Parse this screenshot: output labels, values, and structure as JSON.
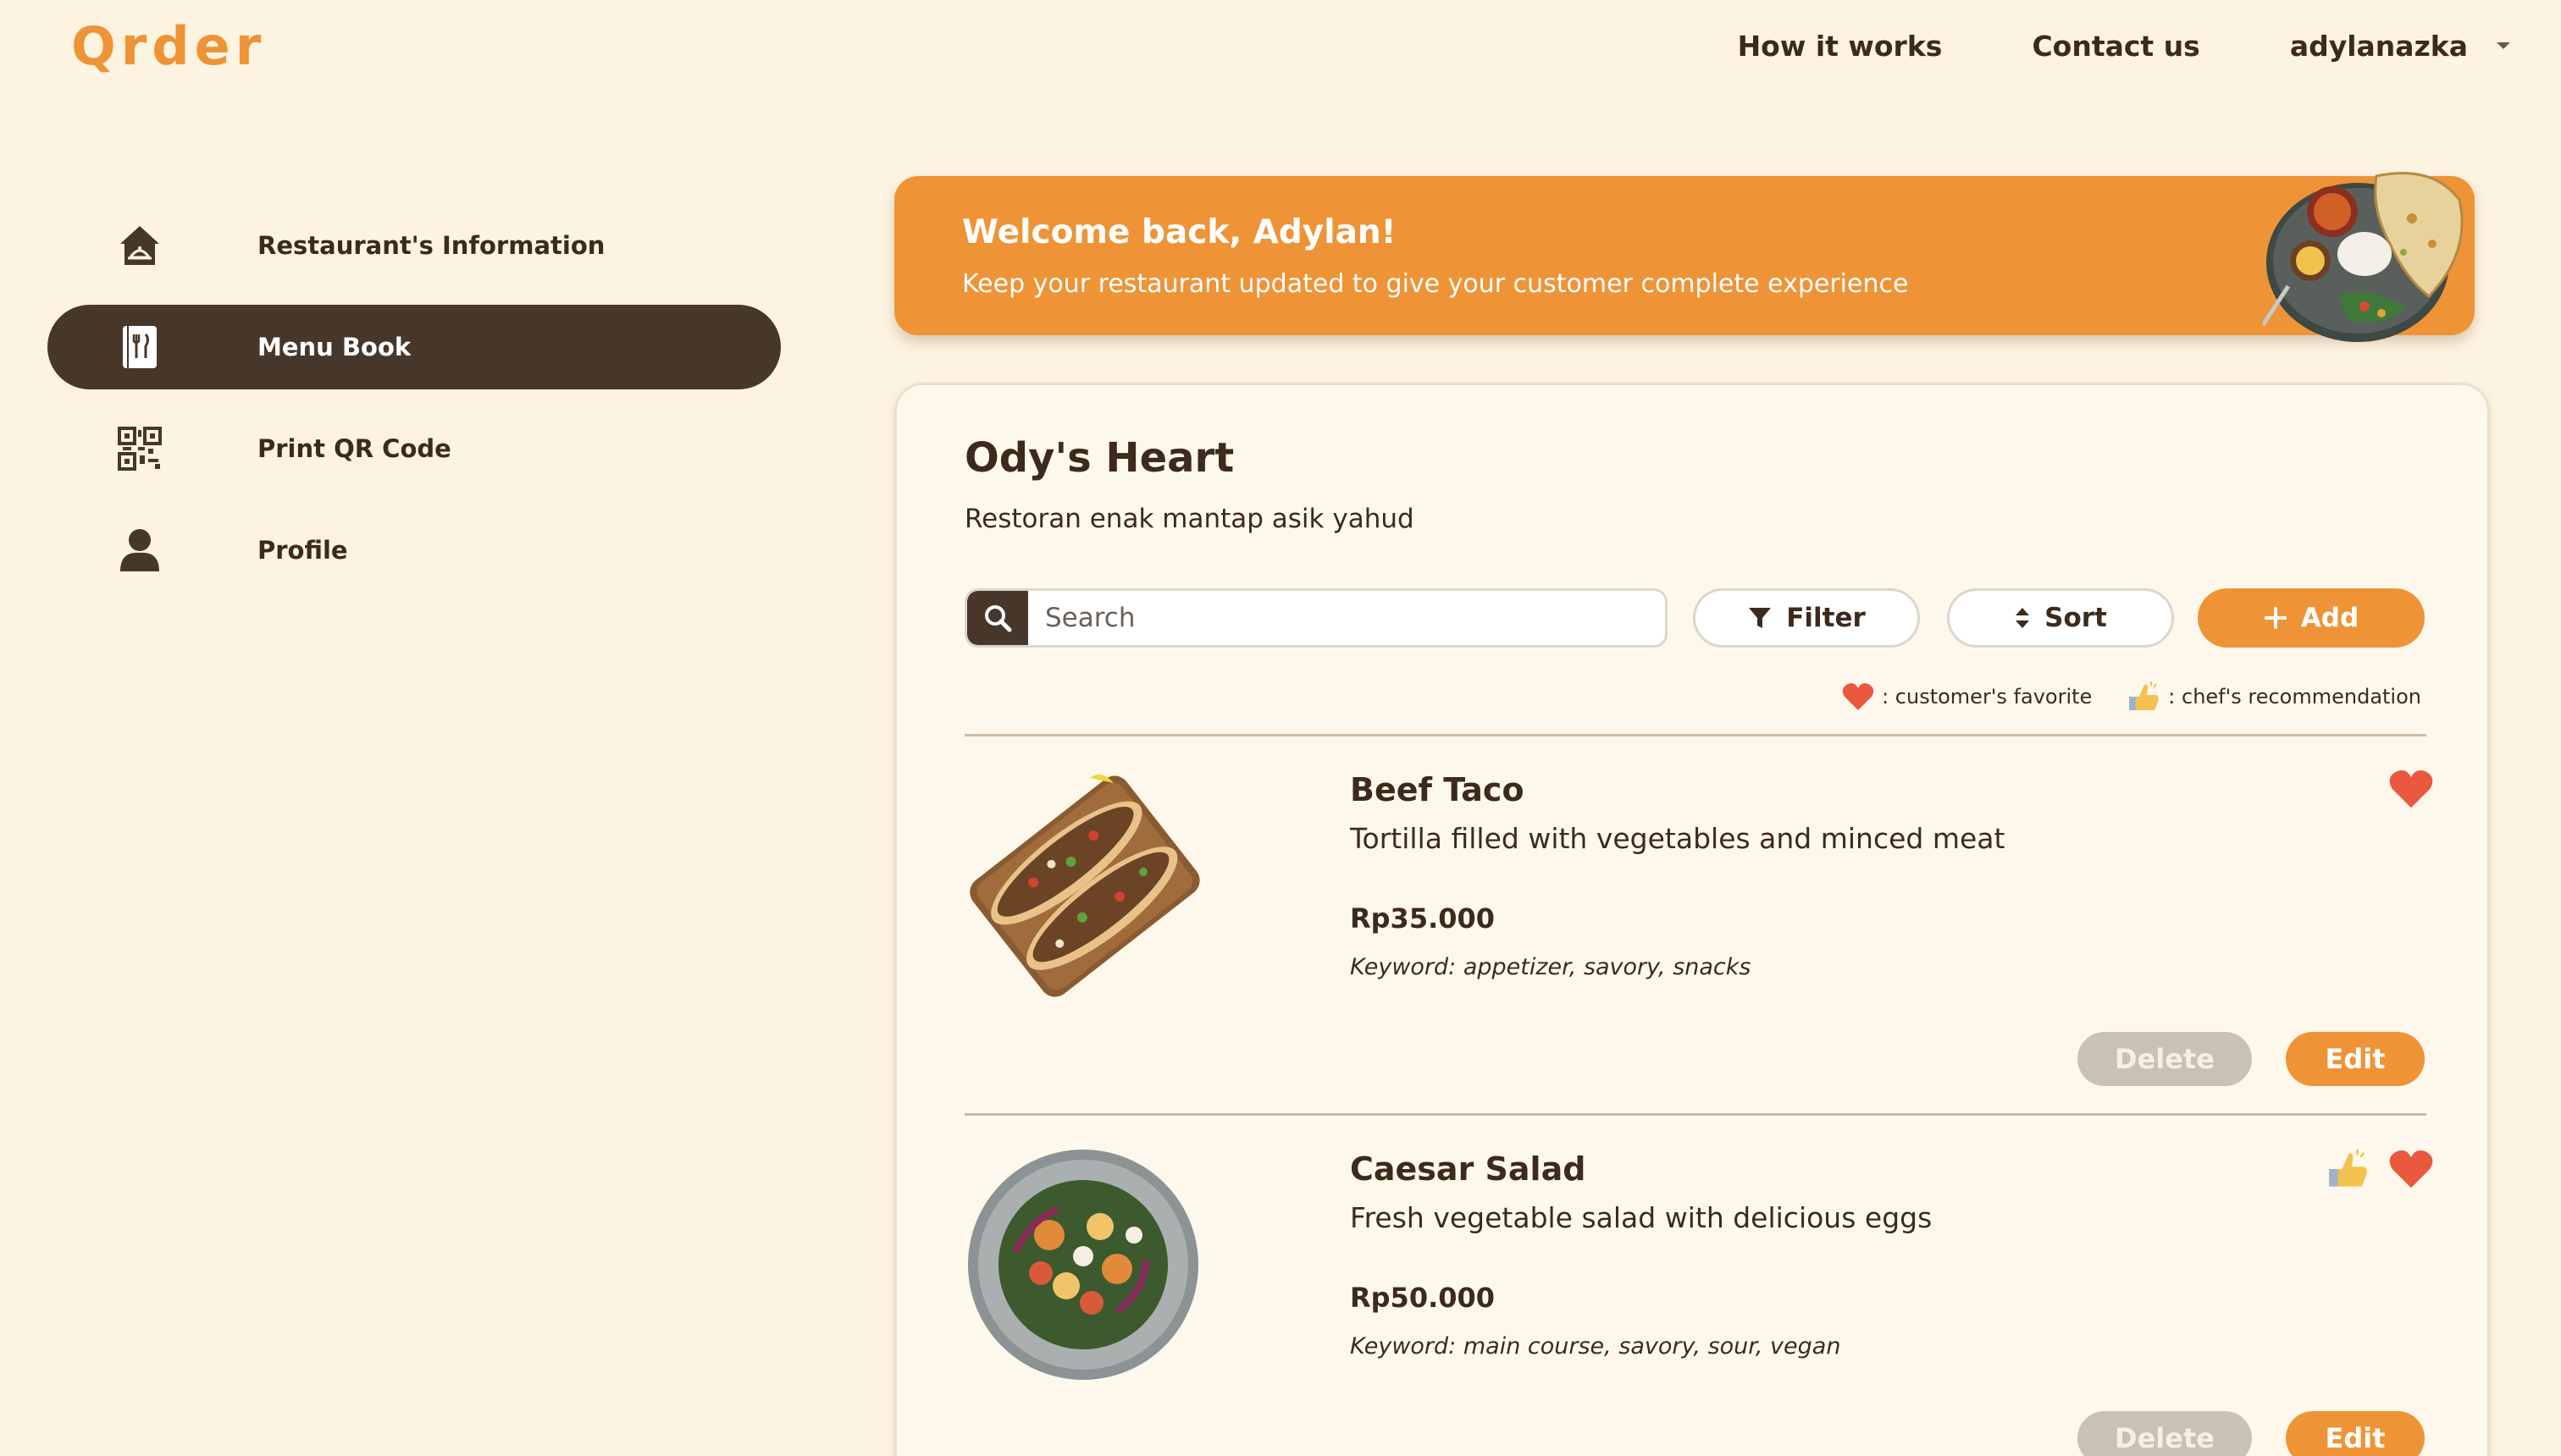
{
  "app": {
    "logo": "Qrder"
  },
  "topnav": {
    "how_it_works": "How it works",
    "contact_us": "Contact us",
    "username": "adylanazka"
  },
  "sidebar": {
    "items": [
      {
        "label": "Restaurant's Information",
        "icon": "home-icon",
        "active": false
      },
      {
        "label": "Menu Book",
        "icon": "menu-book-icon",
        "active": true
      },
      {
        "label": "Print QR Code",
        "icon": "qr-code-icon",
        "active": false
      },
      {
        "label": "Profile",
        "icon": "user-icon",
        "active": false
      }
    ]
  },
  "banner": {
    "title": "Welcome back, Adylan!",
    "subtitle": "Keep your restaurant updated to give your customer complete experience"
  },
  "restaurant": {
    "name": "Ody's Heart",
    "description": "Restoran enak mantap asik yahud"
  },
  "toolbar": {
    "search_placeholder": "Search",
    "filter_label": "Filter",
    "sort_label": "Sort",
    "add_label": "Add"
  },
  "legend": {
    "favorite": ": customer's favorite",
    "recommendation": ": chef's recommendation"
  },
  "menu": {
    "items": [
      {
        "name": "Beef Taco",
        "description": "Tortilla filled with vegetables and minced meat",
        "price": "Rp35.000",
        "keywords": "Keyword: appetizer, savory, snacks",
        "favorite": true,
        "recommended": false,
        "delete_label": "Delete",
        "edit_label": "Edit"
      },
      {
        "name": "Caesar Salad",
        "description": "Fresh vegetable salad with delicious eggs",
        "price": "Rp50.000",
        "keywords": "Keyword: main course, savory, sour, vegan",
        "favorite": true,
        "recommended": true,
        "delete_label": "Delete",
        "edit_label": "Edit"
      }
    ]
  },
  "colors": {
    "background": "#fdf3e1",
    "accent": "#ee9436",
    "dark": "#47372a",
    "heart": "#e9583f"
  }
}
